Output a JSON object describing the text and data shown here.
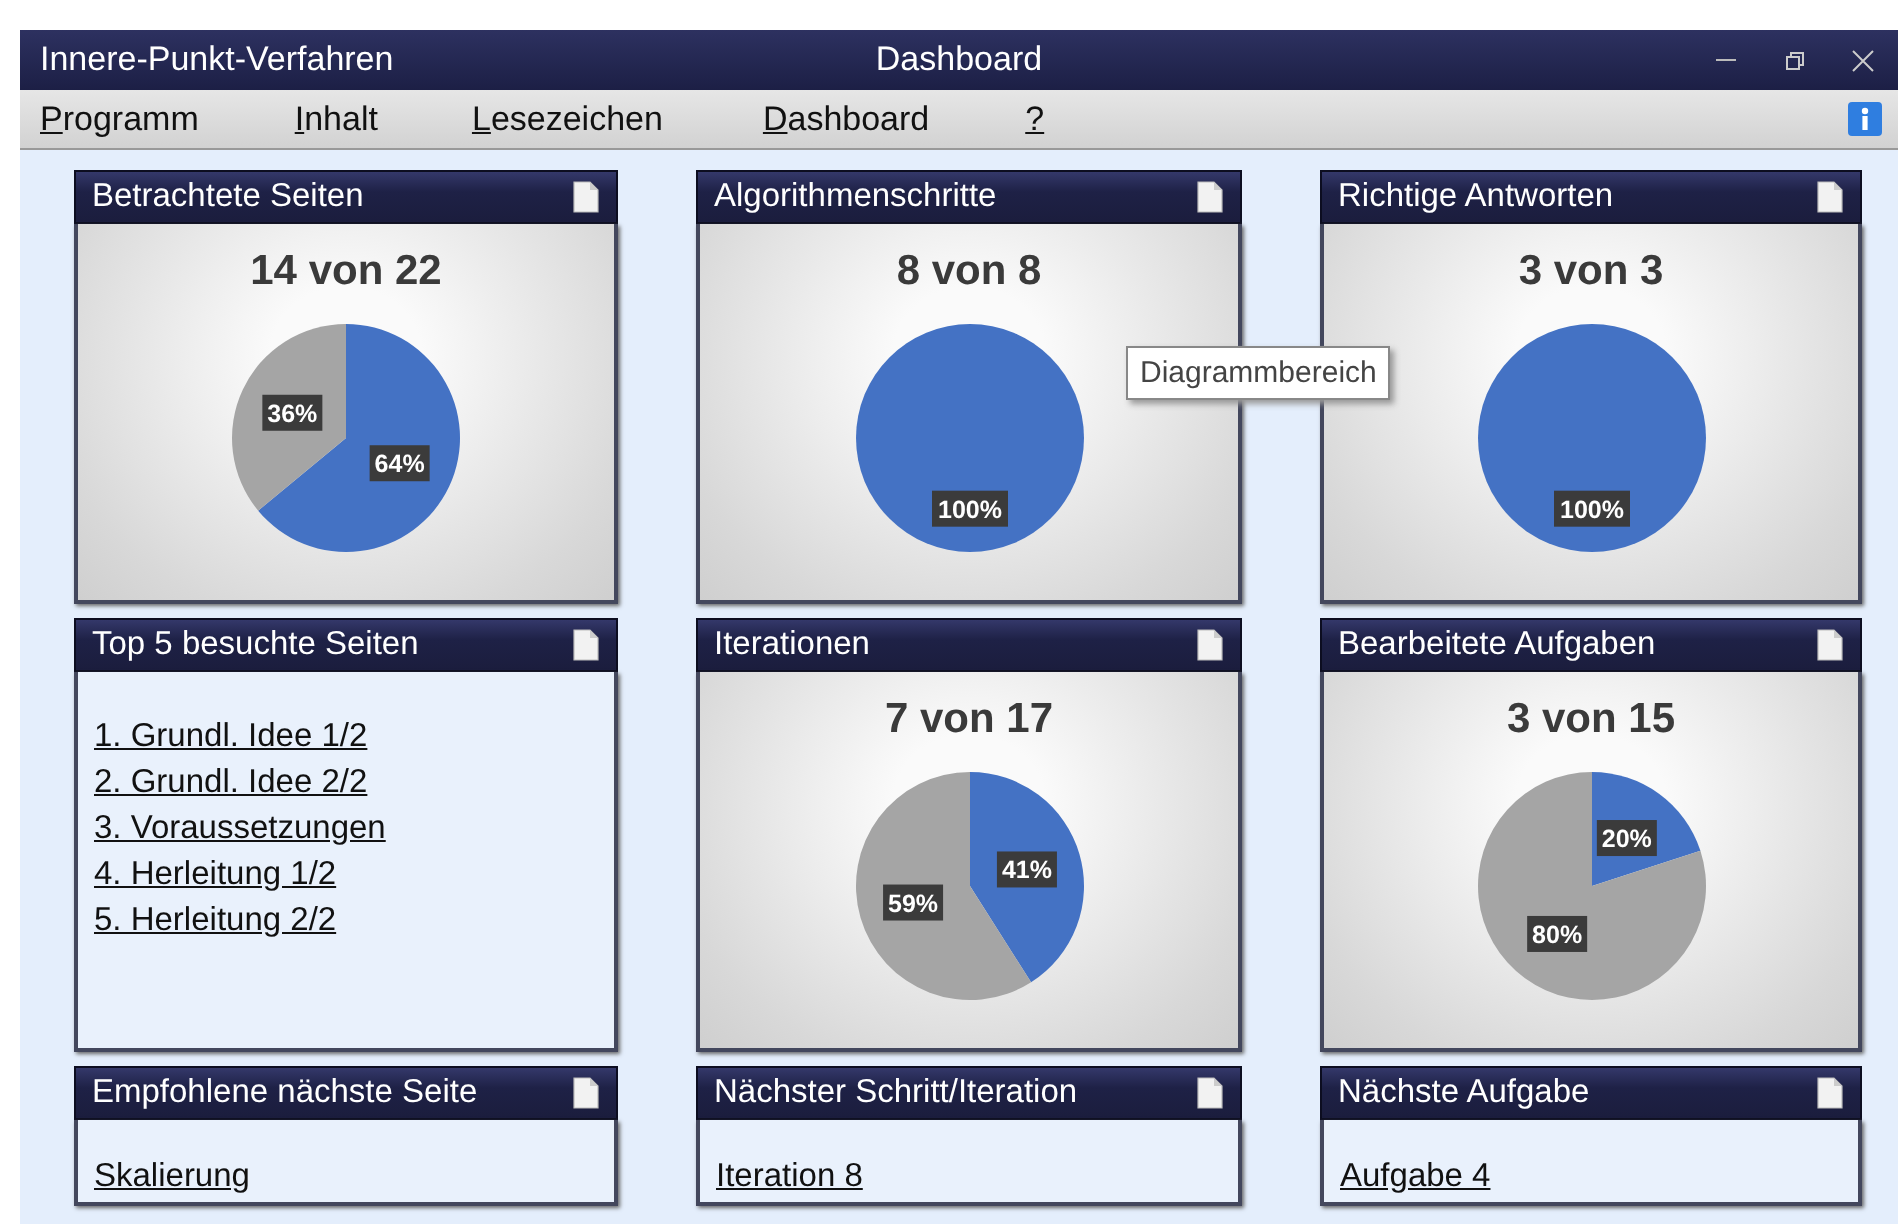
{
  "window": {
    "title": "Innere-Punkt-Verfahren",
    "subtitle": "Dashboard"
  },
  "menu": [
    {
      "label": "Programm"
    },
    {
      "label": "Inhalt"
    },
    {
      "label": "Lesezeichen"
    },
    {
      "label": "Dashboard"
    },
    {
      "label": "?"
    }
  ],
  "cards": [
    {
      "kind": "chart",
      "title": "Betrachtete Seiten",
      "summary": "14 von 22",
      "chart_data": {
        "type": "pie",
        "values": [
          64,
          36
        ],
        "value_labels": [
          "64%",
          "36%"
        ]
      }
    },
    {
      "kind": "chart",
      "title": "Algorithmenschritte",
      "summary": "8 von 8",
      "chart_data": {
        "type": "pie",
        "values": [
          100,
          0
        ],
        "value_labels": [
          "100%",
          null
        ]
      }
    },
    {
      "kind": "chart",
      "title": "Richtige Antworten",
      "summary": "3 von 3",
      "chart_data": {
        "type": "pie",
        "values": [
          100,
          0
        ],
        "value_labels": [
          "100%",
          null
        ]
      }
    },
    {
      "kind": "links",
      "title": "Top 5 besuchte Seiten",
      "links": [
        "1. Grundl. Idee 1/2",
        "2. Grundl. Idee 2/2",
        "3. Voraussetzungen",
        "4. Herleitung 1/2",
        "5. Herleitung 2/2"
      ]
    },
    {
      "kind": "chart",
      "title": "Iterationen",
      "summary": "7 von 17",
      "chart_data": {
        "type": "pie",
        "values": [
          41,
          59
        ],
        "value_labels": [
          "41%",
          "59%"
        ]
      }
    },
    {
      "kind": "chart",
      "title": "Bearbeitete Aufgaben",
      "summary": "3 von 15",
      "chart_data": {
        "type": "pie",
        "values": [
          20,
          80
        ],
        "value_labels": [
          "20%",
          "80%"
        ]
      }
    },
    {
      "kind": "next",
      "title": "Empfohlene nächste Seite",
      "links": [
        "Skalierung"
      ]
    },
    {
      "kind": "next",
      "title": "Nächster Schritt/Iteration",
      "links": [
        "Iteration 8"
      ]
    },
    {
      "kind": "next",
      "title": "Nächste Aufgabe",
      "links": [
        "Aufgabe 4"
      ]
    }
  ],
  "tooltip": {
    "text": "Diagrammbereich"
  }
}
